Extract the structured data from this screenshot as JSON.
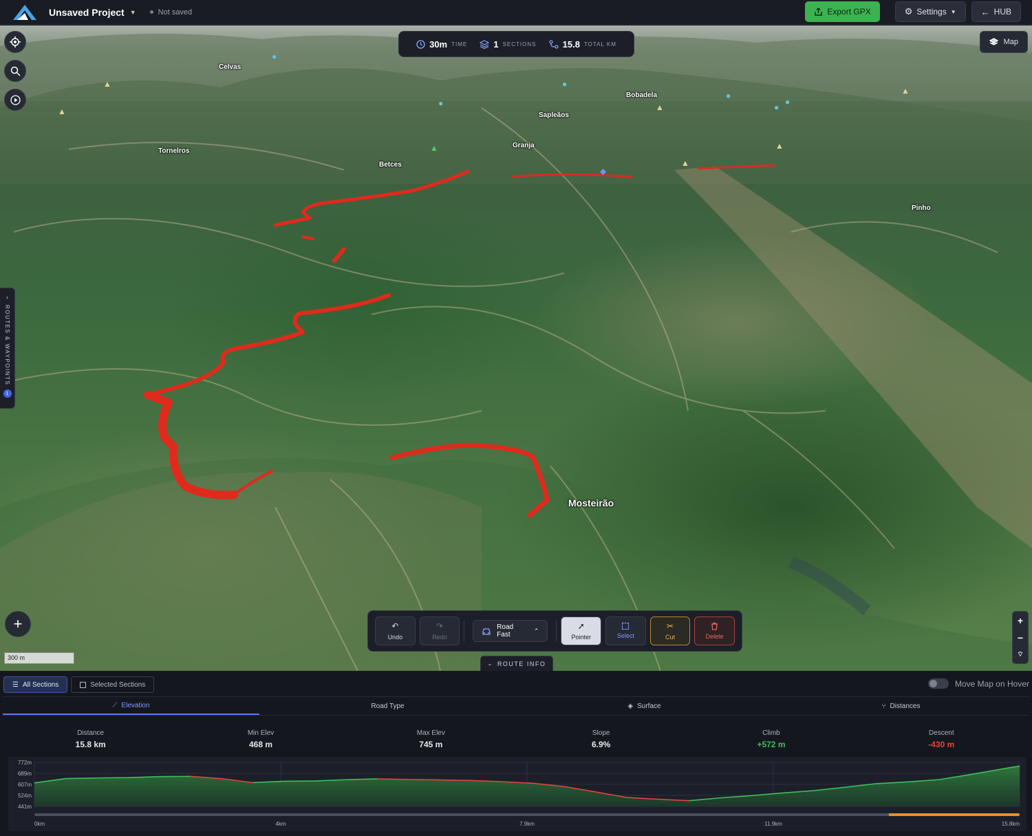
{
  "topbar": {
    "project_title": "Unsaved Project",
    "save_status": "Not saved",
    "export_label": "Export GPX",
    "settings_label": "Settings",
    "hub_label": "HUB"
  },
  "stats": {
    "time_value": "30m",
    "time_label": "TIME",
    "sections_value": "1",
    "sections_label": "SECTIONS",
    "km_value": "15.8",
    "km_label": "TOTAL KM"
  },
  "map": {
    "layer_button": "Map",
    "side_tab_label": "ROUTES & WAYPOINTS",
    "side_tab_badge": "1",
    "scale_label": "300 m",
    "places": [
      "Celvas",
      "Tornelros",
      "Bobadela",
      "Sapleãos",
      "Granja",
      "Betces",
      "Pinho",
      "Mosteirão"
    ]
  },
  "toolbar": {
    "undo": "Undo",
    "redo": "Redo",
    "road_type": "Road Fast",
    "pointer": "Pointer",
    "select": "Select",
    "cut": "Cut",
    "delete": "Delete"
  },
  "route_info_label": "ROUTE INFO",
  "panel": {
    "all_sections": "All Sections",
    "selected_sections": "Selected Sections",
    "move_map_hover": "Move Map on Hover",
    "tabs": [
      "Elevation",
      "Road Type",
      "Surface",
      "Distances"
    ],
    "metrics": [
      {
        "label": "Distance",
        "value": "15.8 km"
      },
      {
        "label": "Min Elev",
        "value": "468 m"
      },
      {
        "label": "Max Elev",
        "value": "745 m"
      },
      {
        "label": "Slope",
        "value": "6.9%"
      },
      {
        "label": "Climb",
        "value": "+572 m"
      },
      {
        "label": "Descent",
        "value": "-430 m"
      }
    ]
  },
  "colors": {
    "accent": "#5b79e8",
    "export_green": "#3db250",
    "route_red": "#e02a1c",
    "climb": "#3fbf5a",
    "descent": "#e2443a"
  },
  "chart_data": {
    "type": "area",
    "ylabel_ticks": [
      "772m",
      "689m",
      "607m",
      "524m",
      "441m"
    ],
    "xlabel_ticks": [
      "0km",
      "4km",
      "7.9km",
      "11.9km",
      "15.8km"
    ],
    "ylim": [
      441,
      772
    ],
    "xlim": [
      0,
      15.8
    ],
    "x": [
      0,
      0.5,
      1.0,
      1.5,
      2.0,
      2.5,
      3.0,
      3.5,
      4.0,
      4.5,
      5.0,
      5.5,
      6.0,
      6.5,
      7.0,
      7.5,
      8.0,
      8.5,
      9.0,
      9.5,
      10.0,
      10.5,
      11.0,
      11.5,
      12.0,
      12.5,
      13.0,
      13.5,
      14.0,
      14.5,
      15.0,
      15.8
    ],
    "elevation": [
      618,
      650,
      655,
      657,
      665,
      667,
      650,
      620,
      630,
      632,
      642,
      648,
      644,
      640,
      636,
      627,
      615,
      590,
      550,
      508,
      495,
      484,
      505,
      522,
      542,
      560,
      585,
      612,
      625,
      642,
      680,
      745
    ]
  }
}
